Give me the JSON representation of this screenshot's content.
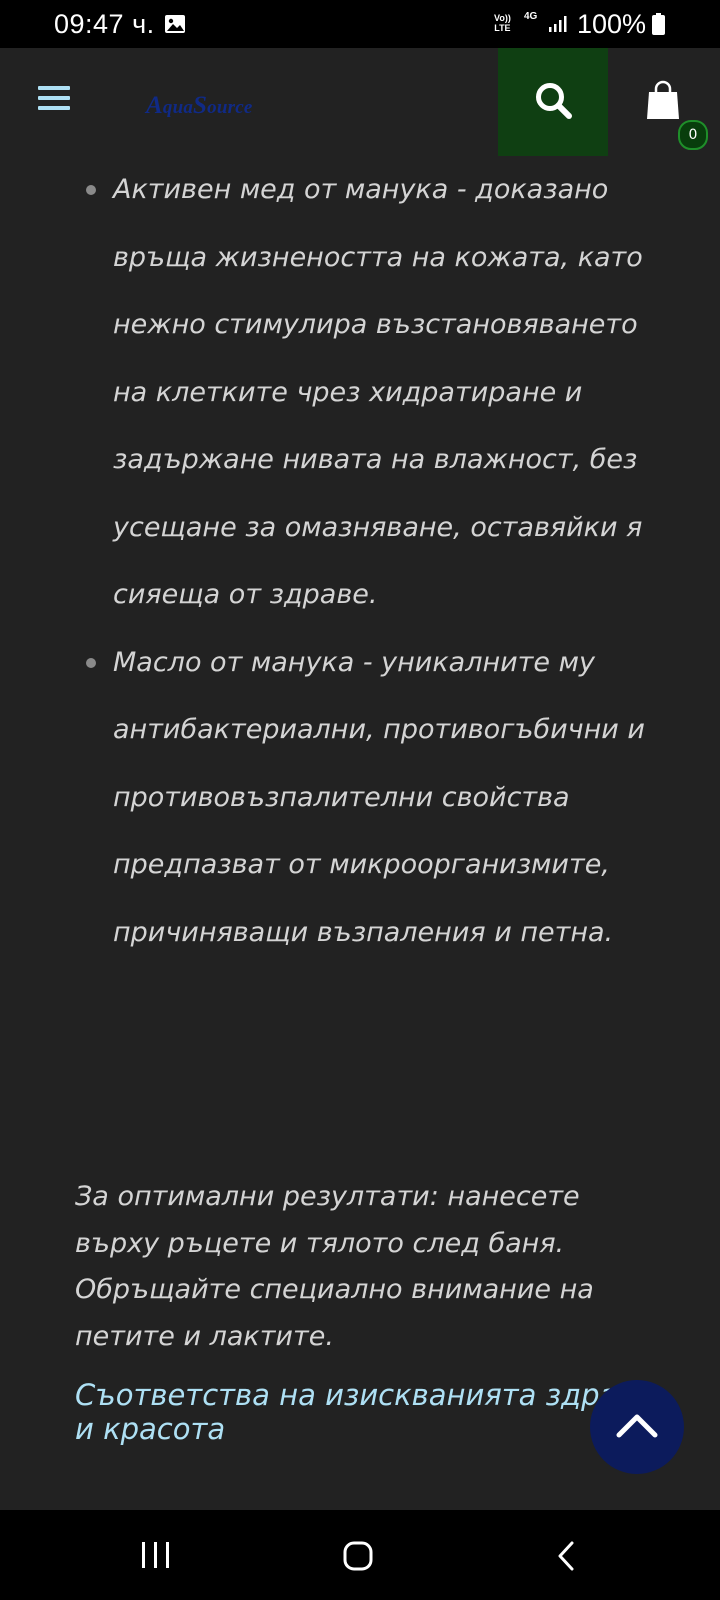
{
  "status_bar": {
    "time": "09:47 ч.",
    "volte_top": "Vo))",
    "volte_bottom": "LTE",
    "network": "4G",
    "battery": "100%",
    "icons": [
      "gallery-icon",
      "signal-icon",
      "battery-icon"
    ]
  },
  "header": {
    "logo_parts": [
      "A",
      "qua",
      "S",
      "ource"
    ],
    "cart_count": "0",
    "search_bg": "#0f3f12",
    "logo_color": "#102a86",
    "accent": "#aee0f4"
  },
  "content": {
    "bullets": [
      "Активен мед от манука - доказано връща жизнеността на кожата, като нежно стимулира възстановяването на клетките чрез хидратиране и задържане нивата на влажност, без усещане за омазняване, оставяйки я сияеща от здраве.",
      "Масло от манука - уникалните му антибактериални, противогъбични и противовъзпалителни свойства предпазват от микроорганизмите, причиняващи възпаления и петна."
    ],
    "paragraph": "За оптимални резултати: нанесете върху ръцете и тялото след баня. Обръщайте специално внимание на петите и лактите.",
    "link": "Съответства на изискванията здраве и красота"
  },
  "nav": {
    "icons": [
      "recent-apps-icon",
      "home-icon",
      "back-icon"
    ]
  }
}
